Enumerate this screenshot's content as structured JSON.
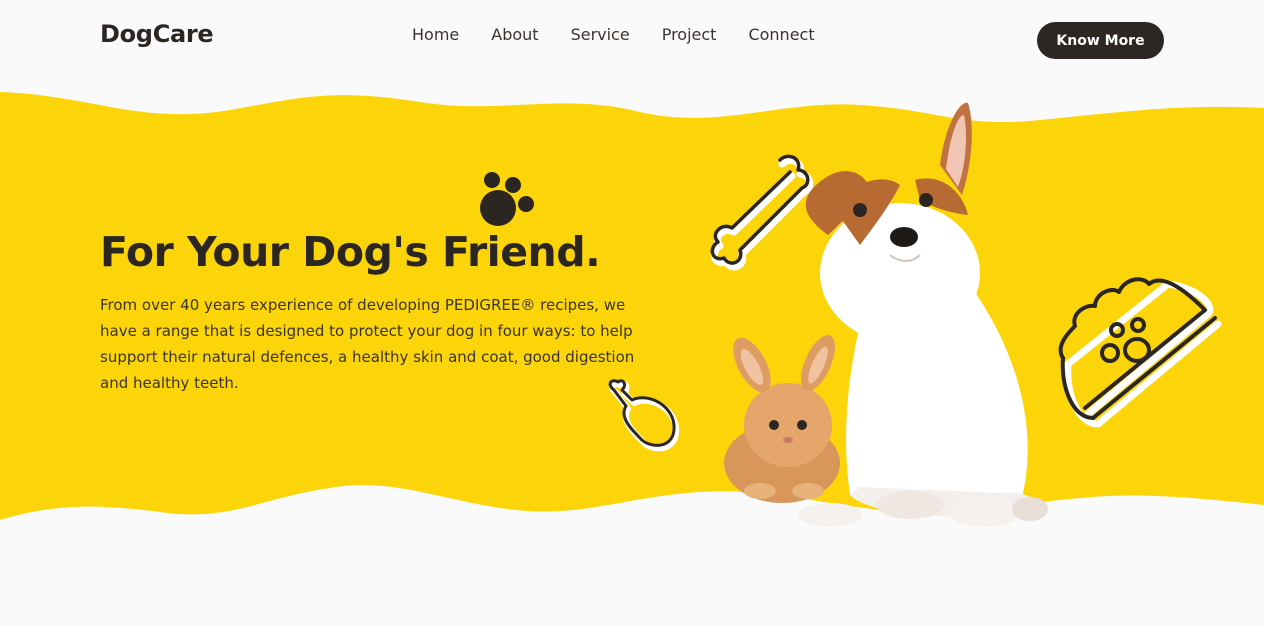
{
  "header": {
    "logo": "DogCare",
    "nav": [
      "Home",
      "About",
      "Service",
      "Project",
      "Connect"
    ],
    "cta_label": "Know More"
  },
  "hero": {
    "title": "For Your Dog's Friend.",
    "description": "From over 40 years experience of developing PEDIGREE® recipes, we have a range that is designed to protect your dog in four ways: to help support their natural defences, a healthy skin and coat, good digestion and healthy teeth."
  },
  "colors": {
    "accent_yellow": "#fcd40a",
    "dark": "#2b2622",
    "background": "#fafafa"
  },
  "icons": [
    "paw-icon",
    "bone-icon",
    "drumstick-icon",
    "food-bowl-icon"
  ]
}
